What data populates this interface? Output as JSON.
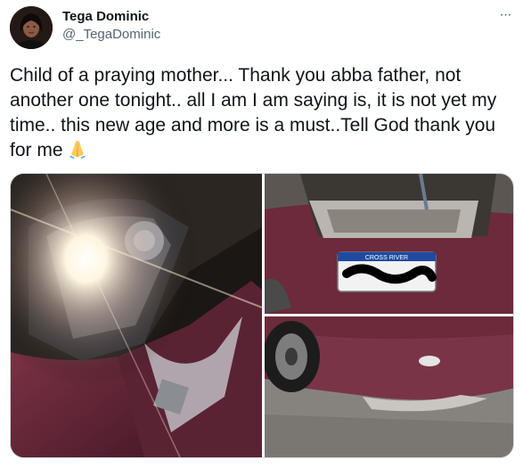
{
  "author": {
    "display_name": "Tega Dominic",
    "handle": "@_TegaDominic",
    "avatar_icon": "profile-photo"
  },
  "menu": {
    "more_label": "···",
    "icon": "more-horizontal-icon"
  },
  "tweet": {
    "text": "Child of a praying mother... Thank you abba father, not another one tonight.. all I am I am saying is, it is not yet my time.. this new age and more is a must..Tell God thank you for me",
    "emoji": "folded-hands-icon"
  },
  "media": {
    "count": 3,
    "plate_text": "CROSS RIVER",
    "car_color": "#6e2a3c"
  }
}
